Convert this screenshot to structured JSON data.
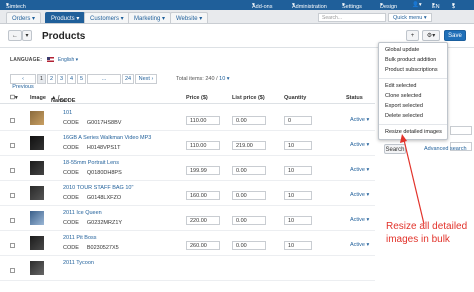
{
  "topbar": {
    "store": "Simtech",
    "addons": "Add-ons",
    "administration": "Administration",
    "settings": "Settings",
    "design": "Design",
    "lang": "EN",
    "currency": "$"
  },
  "nav": {
    "tabs": [
      "Orders",
      "Products",
      "Customers",
      "Marketing",
      "Website"
    ],
    "active_tab": "Products",
    "search_placeholder": "Search...",
    "quick_menu": "Quick menu"
  },
  "page": {
    "title": "Products",
    "save_label": "Save",
    "add_label": "+",
    "gear_label": "⚙"
  },
  "language": {
    "label": "LANGUAGE:",
    "value": "English"
  },
  "pagination": {
    "previous": "‹ Previous",
    "pages": [
      "1",
      "2",
      "3",
      "4",
      "5",
      "...",
      "24"
    ],
    "next": "Next ›",
    "total_label": "Total items:",
    "total_value": "240",
    "per_page": "10"
  },
  "table": {
    "headers": {
      "image": "Image",
      "name": "Name",
      "code": "CODE",
      "price": "Price ($)",
      "list_price": "List price ($)",
      "quantity": "Quantity",
      "status": "Status"
    },
    "code_label": "CODE",
    "rows": [
      {
        "name": "101",
        "code": "G0017HS8BV",
        "price": "110.00",
        "list_price": "0.00",
        "quantity": "0",
        "status": "Active"
      },
      {
        "name": "16GB A Series Walkman Video MP3",
        "code": "H0148VPS1T",
        "price": "110.00",
        "list_price": "219.00",
        "quantity": "10",
        "status": "Active"
      },
      {
        "name": "18-55mm Portrait Lens",
        "code": "Q0180DH8PS",
        "price": "199.99",
        "list_price": "0.00",
        "quantity": "10",
        "status": "Active"
      },
      {
        "name": "2010 TOUR STAFF BAG 10\"",
        "code": "G0148LXFZO",
        "price": "160.00",
        "list_price": "0.00",
        "quantity": "10",
        "status": "Active"
      },
      {
        "name": "2011 Ice Queen",
        "code": "G0232MRZ1Y",
        "price": "220.00",
        "list_price": "0.00",
        "quantity": "10",
        "status": "Active"
      },
      {
        "name": "2011 Pit Boss",
        "code": "B0230527X5",
        "price": "260.00",
        "list_price": "0.00",
        "quantity": "10",
        "status": "Active"
      },
      {
        "name": "2011 Tycoon",
        "code": "",
        "price": "",
        "list_price": "",
        "quantity": "",
        "status": ""
      }
    ]
  },
  "dropdown": {
    "items": [
      "Global update",
      "Bulk product addition",
      "Product subscriptions",
      "Edit selected",
      "Clone selected",
      "Export selected",
      "Delete selected",
      "Resize detailed images"
    ]
  },
  "side": {
    "search_button": "Search",
    "advanced_search": "Advanced search"
  },
  "callout": {
    "text": "Resize all detailed images in bulk"
  },
  "colors": {
    "brand": "#1f5f9a",
    "annotation": "#e2332b"
  }
}
